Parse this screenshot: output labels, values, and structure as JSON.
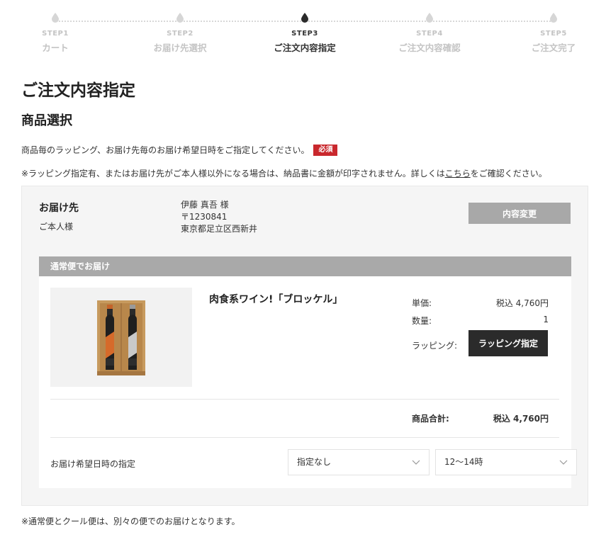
{
  "stepper": {
    "steps": [
      {
        "num": "STEP1",
        "label": "カート",
        "active": false
      },
      {
        "num": "STEP2",
        "label": "お届け先選択",
        "active": false
      },
      {
        "num": "STEP3",
        "label": "ご注文内容指定",
        "active": true
      },
      {
        "num": "STEP4",
        "label": "ご注文内容確認",
        "active": false
      },
      {
        "num": "STEP5",
        "label": "ご注文完了",
        "active": false
      }
    ],
    "colors": {
      "active": "#333333",
      "inactive": "#c4c4c4"
    }
  },
  "page": {
    "title": "ご注文内容指定",
    "section_title": "商品選択",
    "instruction": "商品毎のラッピング、お届け先毎のお届け希望日時をご指定してください。",
    "required_badge": "必須",
    "note_prefix": "※ラッピング指定有、またはお届け先がご本人様以外になる場合は、納品書に金額が印字されません。詳しくは",
    "note_link": "こちら",
    "note_suffix": "をご確認ください。",
    "footnote": "※通常便とクール便は、別々の便でのお届けとなります。"
  },
  "address": {
    "heading": "お届け先",
    "relation": "ご本人様",
    "name": "伊藤 真吾 様",
    "postal": "〒1230841",
    "street": "東京都足立区西新井",
    "change_button": "内容変更"
  },
  "delivery": {
    "method": "通常便でお届け",
    "product": {
      "name": "肉食系ワイン!「ブロッケル」",
      "image_icon": "wine-gift-box-image",
      "unit_price_label": "単価:",
      "unit_price": "税込 4,760円",
      "quantity_label": "数量:",
      "quantity": "1",
      "wrapping_label": "ラッピング:",
      "wrapping_button": "ラッピング指定"
    },
    "subtotal_label": "商品合計:",
    "subtotal": "税込 4,760円",
    "date_label": "お届け希望日時の指定",
    "date_select": "指定なし",
    "time_select": "12〜14時"
  },
  "colors": {
    "required": "#c9282d",
    "header_bar": "#a9a9a9",
    "dark_button": "#2b2b2b",
    "panel_bg": "#f5f5f5"
  }
}
